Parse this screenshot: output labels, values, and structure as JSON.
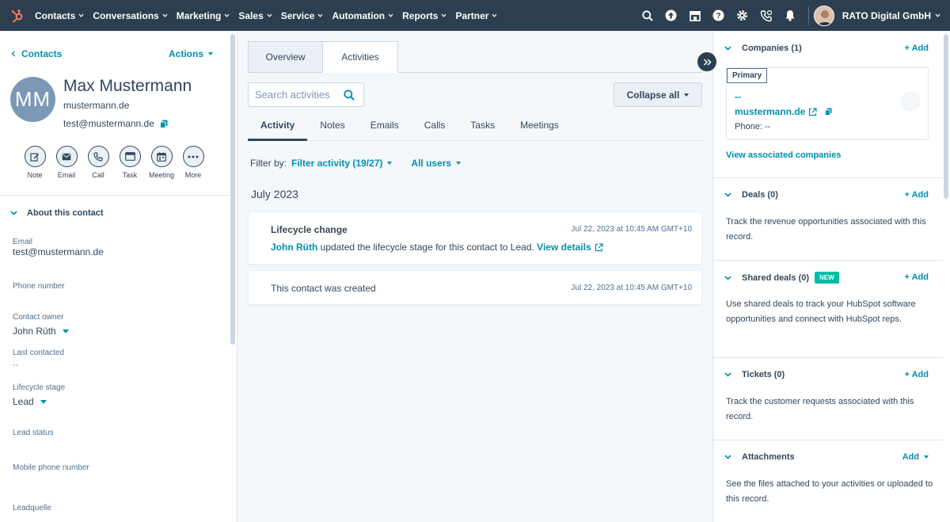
{
  "nav": {
    "items": [
      "Contacts",
      "Conversations",
      "Marketing",
      "Sales",
      "Service",
      "Automation",
      "Reports",
      "Partner"
    ],
    "account": "RATO Digital GmbH"
  },
  "contact": {
    "breadcrumb": "Contacts",
    "actions": "Actions",
    "initials": "MM",
    "name": "Max Mustermann",
    "domain": "mustermann.de",
    "email": "test@mustermann.de",
    "quick_actions": [
      "Note",
      "Email",
      "Call",
      "Task",
      "Meeting",
      "More"
    ],
    "about_title": "About this contact",
    "properties": {
      "email_label": "Email",
      "email_value": "test@mustermann.de",
      "phone_label": "Phone number",
      "owner_label": "Contact owner",
      "owner_value": "John Rüth",
      "last_contacted_label": "Last contacted",
      "last_contacted_value": "--",
      "lifecycle_label": "Lifecycle stage",
      "lifecycle_value": "Lead",
      "lead_status_label": "Lead status",
      "mobile_label": "Mobile phone number",
      "leadquelle_label": "Leadquelle"
    }
  },
  "middle": {
    "tabs": [
      "Overview",
      "Activities"
    ],
    "search_placeholder": "Search activities",
    "collapse_all": "Collapse all",
    "subtabs": [
      "Activity",
      "Notes",
      "Emails",
      "Calls",
      "Tasks",
      "Meetings"
    ],
    "filter_by": "Filter by:",
    "filter_activity": "Filter activity (19/27)",
    "all_users": "All users",
    "month": "July 2023",
    "activities": [
      {
        "title": "Lifecycle change",
        "time": "Jul 22, 2023 at 10:45 AM GMT+10",
        "actor": "John Rüth",
        "text": " updated the lifecycle stage for this contact to Lead. ",
        "link": "View details"
      },
      {
        "title": "This contact was created",
        "time": "Jul 22, 2023 at 10:45 AM GMT+10"
      }
    ]
  },
  "right": {
    "companies": {
      "title": "Companies (1)",
      "add": "+ Add",
      "primary": "Primary",
      "name": "--",
      "domain": "mustermann.de",
      "phone": "Phone: --",
      "view_link": "View associated companies"
    },
    "deals": {
      "title": "Deals (0)",
      "add": "+ Add",
      "text": "Track the revenue opportunities associated with this record."
    },
    "shared_deals": {
      "title": "Shared deals (0)",
      "badge": "NEW",
      "add": "+ Add",
      "text": "Use shared deals to track your HubSpot software opportunities and connect with HubSpot reps."
    },
    "tickets": {
      "title": "Tickets (0)",
      "add": "+ Add",
      "text": "Track the customer requests associated with this record."
    },
    "attachments": {
      "title": "Attachments",
      "add": "Add",
      "text": "See the files attached to your activities or uploaded to this record."
    }
  },
  "colors": {
    "nav_bg": "#2d3e50",
    "link": "#0091ae",
    "text": "#33475b",
    "logo": "#ff7a59",
    "new_badge": "#00bda5"
  }
}
